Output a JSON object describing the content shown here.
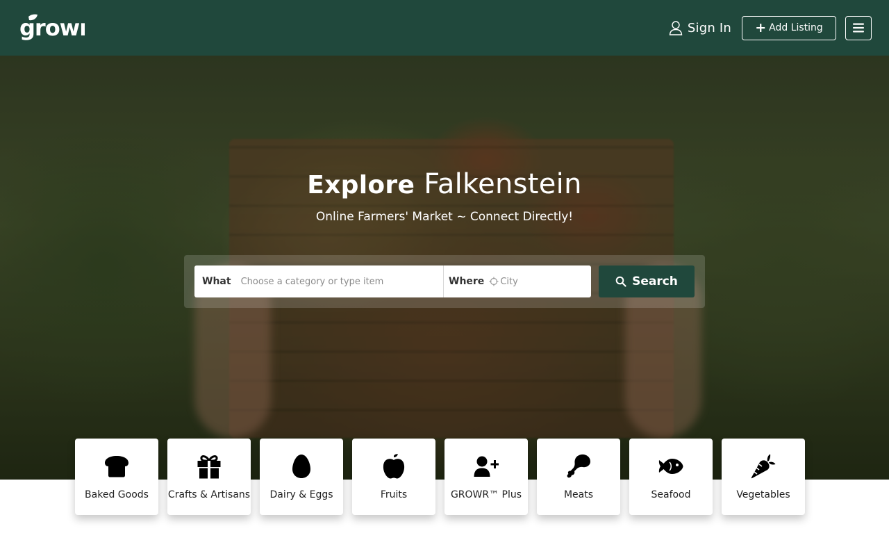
{
  "header": {
    "logo_text": "growr",
    "sign_in_label": "Sign In",
    "add_listing_label": "Add Listing",
    "add_listing_icon": "plus-icon",
    "menu_icon": "hamburger-menu-icon",
    "background_color": "#20483c"
  },
  "hero": {
    "title_bold": "Explore",
    "title_light": "Falkenstein",
    "subtitle": "Online Farmers' Market ~ Connect Directly!",
    "search": {
      "what_label": "What",
      "what_placeholder": "Choose a category or type item",
      "where_label": "Where",
      "where_placeholder": "City",
      "where_icon": "crosshair-locate-icon",
      "button_label": "Search",
      "button_icon": "search-icon"
    }
  },
  "categories": [
    {
      "label": "Baked Goods",
      "icon": "bread-icon"
    },
    {
      "label": "Crafts & Artisans",
      "icon": "gift-icon"
    },
    {
      "label": "Dairy & Eggs",
      "icon": "egg-icon"
    },
    {
      "label": "Fruits",
      "icon": "apple-icon"
    },
    {
      "label": "GROWR™ Plus",
      "icon": "user-plus-icon"
    },
    {
      "label": "Meats",
      "icon": "drumstick-icon"
    },
    {
      "label": "Seafood",
      "icon": "fish-icon"
    },
    {
      "label": "Vegetables",
      "icon": "carrot-icon"
    }
  ],
  "colors": {
    "brand_green": "#20483c",
    "card_background": "#ffffff",
    "text_dark": "#222222"
  }
}
